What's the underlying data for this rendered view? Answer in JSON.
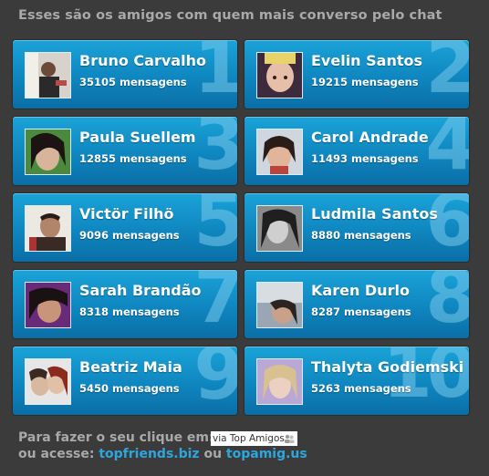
{
  "header": {
    "title": "Esses são os amigos com quem mais converso pelo chat"
  },
  "friends": [
    {
      "rank": "1",
      "name": "Bruno Carvalho",
      "count": "35105 mensagens"
    },
    {
      "rank": "2",
      "name": "Evelin Santos",
      "count": "19215 mensagens"
    },
    {
      "rank": "3",
      "name": "Paula Suellem",
      "count": "12855 mensagens"
    },
    {
      "rank": "4",
      "name": "Carol Andrade",
      "count": "11493 mensagens"
    },
    {
      "rank": "5",
      "name": "Victör Filhö",
      "count": "9096 mensagens"
    },
    {
      "rank": "6",
      "name": "Ludmila Santos",
      "count": "8880 mensagens"
    },
    {
      "rank": "7",
      "name": "Sarah Brandão",
      "count": "8318 mensagens"
    },
    {
      "rank": "8",
      "name": "Karen Durlo",
      "count": "8287 mensagens"
    },
    {
      "rank": "9",
      "name": "Beatriz Maia",
      "count": "5450 mensagens"
    },
    {
      "rank": "10",
      "name": "Thalyta Godiemski",
      "count": "5263 mensagens"
    }
  ],
  "footer": {
    "prompt": "Para fazer o seu clique em:",
    "badge_label": "via Top Amigos",
    "or_visit": "ou acesse:",
    "link1": "topfriends.biz",
    "separator": "ou",
    "link2": "topamig.us"
  },
  "colors": {
    "card_top": "#1aa3d8",
    "card_bottom": "#0b6ea6",
    "link": "#2ea6dd",
    "text_muted": "#a9a9a9"
  }
}
